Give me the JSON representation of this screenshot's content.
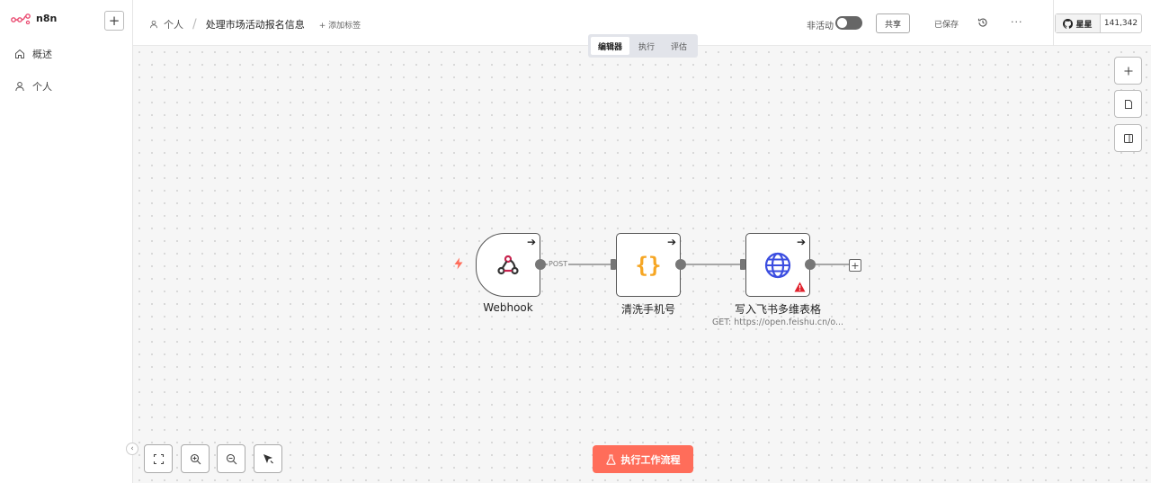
{
  "sidebar": {
    "logo_text": "n8n",
    "add_label": "+",
    "items": [
      {
        "label": "概述",
        "icon": "home-icon"
      },
      {
        "label": "个人",
        "icon": "user-icon"
      }
    ]
  },
  "header": {
    "breadcrumb_owner": "个人",
    "workflow_title": "处理市场活动报名信息",
    "add_tag": "+ 添加标签",
    "inactive_label": "非活动",
    "share_label": "共享",
    "saved_label": "已保存",
    "more_label": "···",
    "star_label": "星星",
    "star_count": "141,342"
  },
  "tabs": [
    "编辑器",
    "执行",
    "评估"
  ],
  "nodes": [
    {
      "name": "Webhook",
      "icon": "webhook-icon"
    },
    {
      "name": "清洗手机号",
      "icon": "code-braces-icon"
    },
    {
      "name": "写入飞书多维表格",
      "icon": "globe-icon",
      "subtitle": "GET: https://open.feishu.cn/o..."
    }
  ],
  "edge_label": "POST",
  "execute_label": "执行工作流程",
  "colors": {
    "accent": "#ff6d5a",
    "webhook": "#c7234e",
    "code": "#f6a623",
    "globe": "#3b4de0",
    "warning": "#e0202b"
  }
}
